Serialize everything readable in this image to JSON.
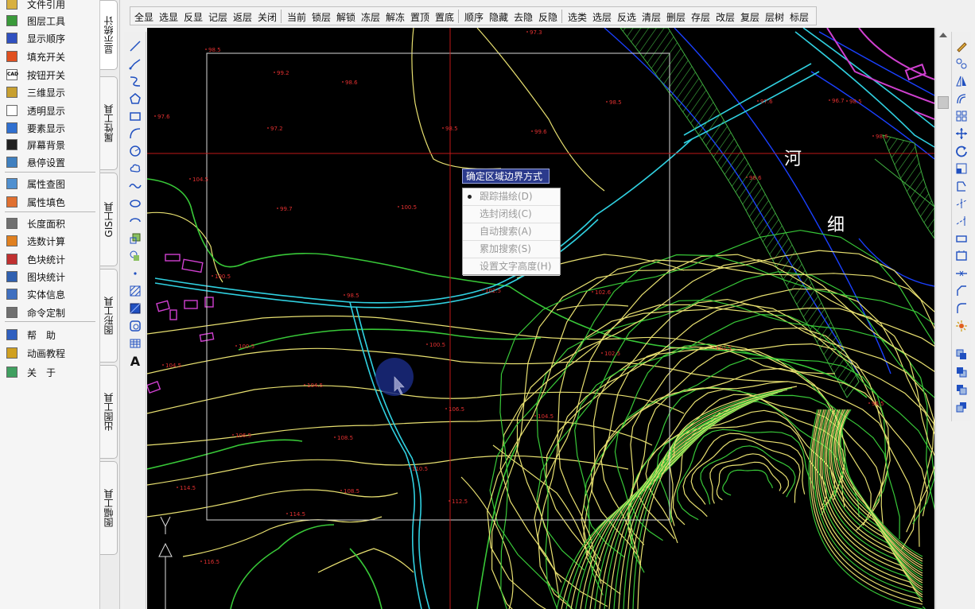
{
  "left_panel": {
    "items": [
      {
        "label": "文件引用",
        "icon": "file-ref-icon",
        "color": "#d8b040"
      },
      {
        "label": "图层工具",
        "icon": "layer-tool-icon",
        "color": "#3a9a3a"
      },
      {
        "label": "显示顺序",
        "icon": "display-order-icon",
        "color": "#3050c0"
      },
      {
        "label": "填充开关",
        "icon": "fill-toggle-icon",
        "color": "#e05020"
      },
      {
        "label": "按钮开关",
        "icon": "cad-button-icon",
        "color": "#ffffff",
        "text": "CAD"
      },
      {
        "label": "三维显示",
        "icon": "3d-display-icon",
        "color": "#c8a030"
      },
      {
        "label": "透明显示",
        "icon": "transparent-icon",
        "color": "#ffffff"
      },
      {
        "label": "要素显示",
        "icon": "feature-display-icon",
        "color": "#3070d0"
      },
      {
        "label": "屏幕背景",
        "icon": "screen-bg-icon",
        "color": "#202020"
      },
      {
        "label": "悬停设置",
        "icon": "hover-settings-icon",
        "color": "#4080c0"
      },
      {
        "label": "属性查图",
        "icon": "attr-search-icon",
        "color": "#5090d0"
      },
      {
        "label": "属性填色",
        "icon": "attr-fill-icon",
        "color": "#e07030"
      },
      {
        "label": "长度面积",
        "icon": "length-area-icon",
        "color": "#707070"
      },
      {
        "label": "选数计算",
        "icon": "select-calc-icon",
        "color": "#e08020"
      },
      {
        "label": "色块统计",
        "icon": "color-block-icon",
        "color": "#c03030"
      },
      {
        "label": "图块统计",
        "icon": "block-stat-icon",
        "color": "#3060b0"
      },
      {
        "label": "实体信息",
        "icon": "entity-info-icon",
        "color": "#4070c0"
      },
      {
        "label": "命令定制",
        "icon": "gear-icon",
        "color": "#707070"
      },
      {
        "label": "帮　助",
        "icon": "help-icon",
        "color": "#3060c0"
      },
      {
        "label": "动画教程",
        "icon": "animation-icon",
        "color": "#d0a020"
      },
      {
        "label": "关　于",
        "icon": "about-icon",
        "color": "#40a060"
      }
    ]
  },
  "vertical_tabs": [
    "显示统计",
    "属性工具",
    "GIS工具",
    "图形工具",
    "出图工具",
    "图幅工具"
  ],
  "toolbar": {
    "groups": [
      [
        "全显",
        "选显",
        "反显",
        "记层",
        "返层",
        "关闭"
      ],
      [
        "当前",
        "锁层",
        "解锁",
        "冻层",
        "解冻",
        "置顶",
        "置底"
      ],
      [
        "顺序",
        "隐藏",
        "去隐",
        "反隐"
      ],
      [
        "选类",
        "选层",
        "反选",
        "清层",
        "删层",
        "存层",
        "改层",
        "复层",
        "层树",
        "标层"
      ]
    ]
  },
  "popup": {
    "title": "确定区域边界方式",
    "items": [
      "跟踪描绘(D)",
      "选封闭线(C)",
      "自动搜索(A)",
      "累加搜索(S)",
      "设置文字高度(H)"
    ],
    "selected_index": 0
  },
  "canvas": {
    "background": "#000000",
    "map_labels": [
      "河",
      "细"
    ],
    "elevations": [
      "97.3",
      "98.5",
      "99.2",
      "98.6",
      "97.6",
      "97.2",
      "98.5",
      "99.6",
      "98.5",
      "99.7",
      "100.5",
      "100.5",
      "98.5",
      "102.5",
      "102.6",
      "100.5",
      "100.5",
      "102.5",
      "102.5",
      "104.5",
      "104.5",
      "106.5",
      "104.5",
      "106.5",
      "108.5",
      "110.5",
      "108.5",
      "114.5",
      "112.5",
      "114.5",
      "116.5",
      "97.6",
      "98.5",
      "99.0",
      "96.7",
      "98.6",
      "98.6",
      "104.5",
      "96.5"
    ]
  },
  "colors": {
    "contour_yellow": "#e8e070",
    "contour_green": "#38c838",
    "river_cyan": "#30d0e0",
    "road_blue": "#1a40ff",
    "magenta": "#d040d0",
    "crosshair_red": "#c01818",
    "elevation_red": "#e03030",
    "hatch_green": "#40b040"
  }
}
